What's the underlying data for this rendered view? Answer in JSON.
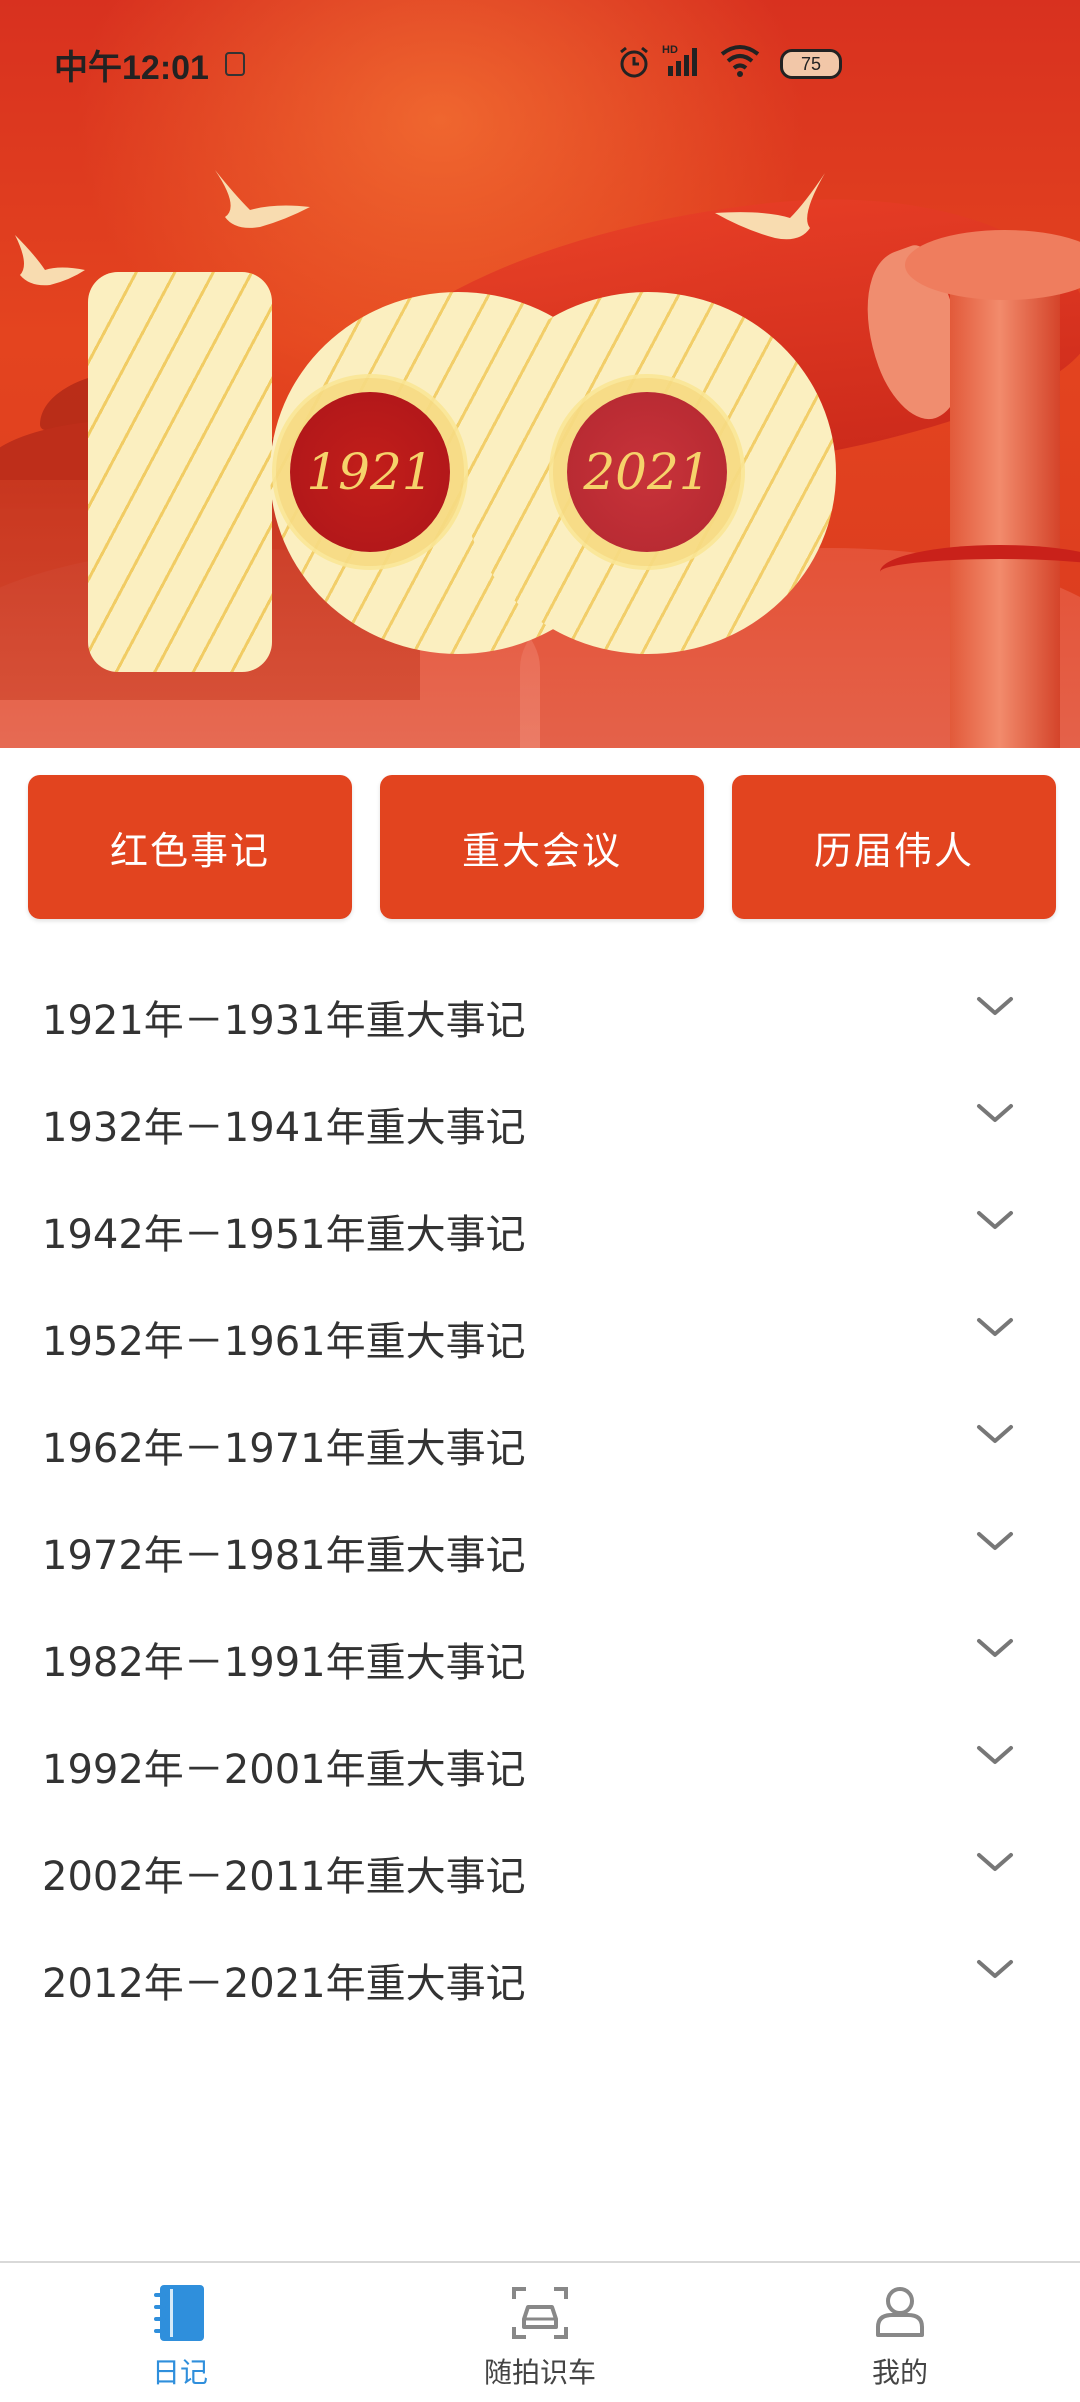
{
  "status_bar": {
    "time": "中午12:01",
    "battery": "75",
    "icons": [
      "alarm-icon",
      "signal-icon",
      "wifi-icon",
      "battery-icon"
    ]
  },
  "banner": {
    "year_start": "1921",
    "year_end": "2021",
    "colors": {
      "red": "#d8311f",
      "cream": "#fbefc0",
      "gold": "#f6d36b"
    }
  },
  "categories": [
    {
      "label": "红色事记"
    },
    {
      "label": "重大会议"
    },
    {
      "label": "历届伟人"
    }
  ],
  "events": [
    {
      "label": "1921年－1931年重大事记"
    },
    {
      "label": "1932年－1941年重大事记"
    },
    {
      "label": "1942年－1951年重大事记"
    },
    {
      "label": "1952年－1961年重大事记"
    },
    {
      "label": "1962年－1971年重大事记"
    },
    {
      "label": "1972年－1981年重大事记"
    },
    {
      "label": "1982年－1991年重大事记"
    },
    {
      "label": "1992年－2001年重大事记"
    },
    {
      "label": "2002年－2011年重大事记"
    },
    {
      "label": "2012年－2021年重大事记"
    }
  ],
  "bottom_nav": [
    {
      "label": "日记",
      "icon": "notebook-icon",
      "active": true
    },
    {
      "label": "随拍识车",
      "icon": "car-camera-icon",
      "active": false
    },
    {
      "label": "我的",
      "icon": "user-icon",
      "active": false
    }
  ],
  "accent_colors": {
    "button": "#e2441f",
    "active_nav": "#2f8fdc"
  }
}
